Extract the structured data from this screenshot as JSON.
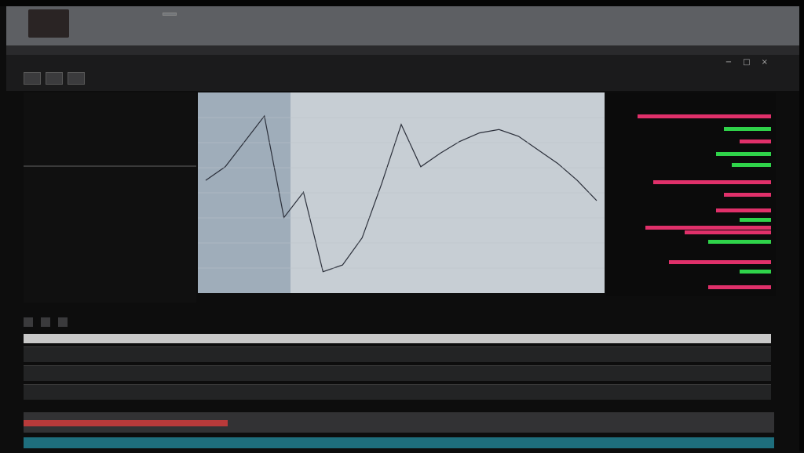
{
  "browser": {
    "title": "",
    "badge": "",
    "nav_link": "",
    "favicon_icon": "favicon-icon"
  },
  "toolbar": {
    "menu": [
      "",
      "",
      ""
    ],
    "controls": [
      "−",
      "□",
      "×"
    ],
    "buttons": [
      "",
      "",
      ""
    ]
  },
  "left_panel": {
    "title": "",
    "rows_top": [
      {
        "label": "",
        "value": ""
      },
      {
        "label": "",
        "value": ""
      },
      {
        "label": "",
        "value": ""
      },
      {
        "label": "",
        "value": ""
      },
      {
        "label": "",
        "value": ""
      }
    ],
    "rows_bottom": [
      {
        "label": "",
        "value": ""
      },
      {
        "label": "",
        "value": ""
      },
      {
        "label": "",
        "value": ""
      },
      {
        "label": "",
        "value": ""
      },
      {
        "label": "",
        "value": ""
      },
      {
        "label": "",
        "value": ""
      }
    ]
  },
  "chart": {
    "accent_color": "#2b2f3a",
    "secondary_color": "#e3c87d",
    "series": [
      {
        "x": [
          0,
          5,
          10,
          15,
          20,
          25,
          30,
          35,
          40,
          45,
          50,
          55,
          60,
          65,
          70,
          75,
          80,
          85,
          90,
          95,
          100
        ],
        "y": [
          62,
          70,
          85,
          100,
          40,
          55,
          8,
          12,
          28,
          60,
          95,
          70,
          78,
          85,
          90,
          92,
          88,
          80,
          72,
          62,
          50
        ]
      }
    ]
  },
  "depth": {
    "ask_color": "#e0306a",
    "bid_color": "#2fd34a"
  },
  "bottom": {
    "tabs": [
      "",
      "",
      ""
    ],
    "filters": [
      "",
      "",
      ""
    ],
    "table_header": [
      "",
      "",
      ""
    ],
    "rows": [
      [
        "",
        "",
        ""
      ],
      [
        "",
        "",
        ""
      ],
      [
        "",
        "",
        ""
      ]
    ],
    "status_color": "#b83a3a",
    "footer": ""
  }
}
